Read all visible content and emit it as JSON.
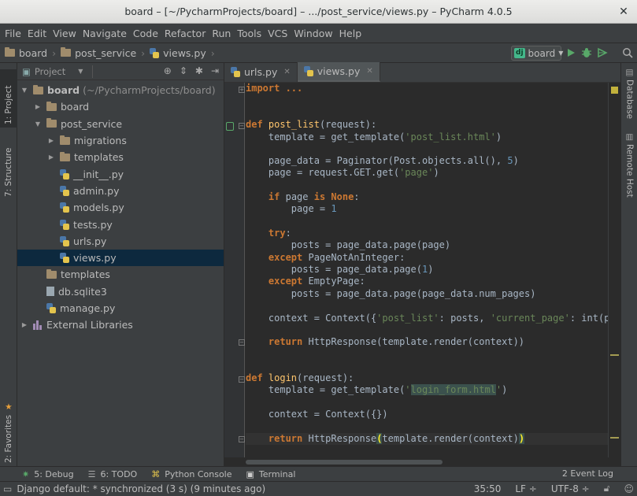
{
  "window": {
    "title": "board – [~/PycharmProjects/board] – .../post_service/views.py – PyCharm 4.0.5"
  },
  "menu": [
    "File",
    "Edit",
    "View",
    "Navigate",
    "Code",
    "Refactor",
    "Run",
    "Tools",
    "VCS",
    "Window",
    "Help"
  ],
  "breadcrumbs": [
    "board",
    "post_service",
    "views.py"
  ],
  "run_config": {
    "badge": "dj",
    "name": "board"
  },
  "left_tabs": {
    "project": "1: Project",
    "structure": "7: Structure",
    "favorites": "2: Favorites"
  },
  "right_tabs": {
    "database": "Database",
    "remote_host": "Remote Host"
  },
  "project_panel": {
    "view_selector": "Project",
    "tree": [
      {
        "name": "board",
        "hint": "(~/PycharmProjects/board)",
        "depth": 0,
        "type": "folder",
        "expanded": true
      },
      {
        "name": "board",
        "depth": 1,
        "type": "folder",
        "expanded": false
      },
      {
        "name": "post_service",
        "depth": 1,
        "type": "folder",
        "expanded": true
      },
      {
        "name": "migrations",
        "depth": 2,
        "type": "folder",
        "expanded": false
      },
      {
        "name": "templates",
        "depth": 2,
        "type": "folder",
        "expanded": false
      },
      {
        "name": "__init__.py",
        "depth": 2,
        "type": "py"
      },
      {
        "name": "admin.py",
        "depth": 2,
        "type": "py"
      },
      {
        "name": "models.py",
        "depth": 2,
        "type": "py"
      },
      {
        "name": "tests.py",
        "depth": 2,
        "type": "py"
      },
      {
        "name": "urls.py",
        "depth": 2,
        "type": "py"
      },
      {
        "name": "views.py",
        "depth": 2,
        "type": "py",
        "selected": true
      },
      {
        "name": "templates",
        "depth": 1,
        "type": "folder"
      },
      {
        "name": "db.sqlite3",
        "depth": 1,
        "type": "file"
      },
      {
        "name": "manage.py",
        "depth": 1,
        "type": "py"
      },
      {
        "name": "External Libraries",
        "depth": 0,
        "type": "lib",
        "expanded": false
      }
    ]
  },
  "editor": {
    "tabs": [
      {
        "label": "urls.py",
        "active": false
      },
      {
        "label": "views.py",
        "active": true
      }
    ],
    "code_lines": [
      "import ...",
      "",
      "",
      "def post_list(request):",
      "    template = get_template('post_list.html')",
      "",
      "    page_data = Paginator(Post.objects.all(), 5)",
      "    page = request.GET.get('page')",
      "",
      "    if page is None:",
      "        page = 1",
      "",
      "    try:",
      "        posts = page_data.page(page)",
      "    except PageNotAnInteger:",
      "        posts = page_data.page(1)",
      "    except EmptyPage:",
      "        posts = page_data.page(page_data.num_pages)",
      "",
      "    context = Context({'post_list': posts, 'current_page': int(page)",
      "",
      "    return HttpResponse(template.render(context))",
      "",
      "",
      "def login(request):",
      "    template = get_template('login_form.html')",
      "",
      "    context = Context({})",
      "",
      "    return HttpResponse(template.render(context))"
    ]
  },
  "bottom_tools": [
    {
      "label": "5: Debug",
      "icon": "bug-icon"
    },
    {
      "label": "6: TODO",
      "icon": "todo-icon"
    },
    {
      "label": "Python Console",
      "icon": "python-console-icon"
    },
    {
      "label": "Terminal",
      "icon": "terminal-icon"
    }
  ],
  "event_log": "2 Event Log",
  "status": {
    "message": "Django default: * synchronized (3 s) (9 minutes ago)",
    "position": "35:50",
    "line_sep": "LF ÷",
    "encoding": "UTF-8 ÷"
  },
  "colors": {
    "keyword": "#cc7832",
    "string": "#6a8759",
    "number": "#6897bb",
    "function": "#ffc66d",
    "selection": "#0d293e"
  }
}
